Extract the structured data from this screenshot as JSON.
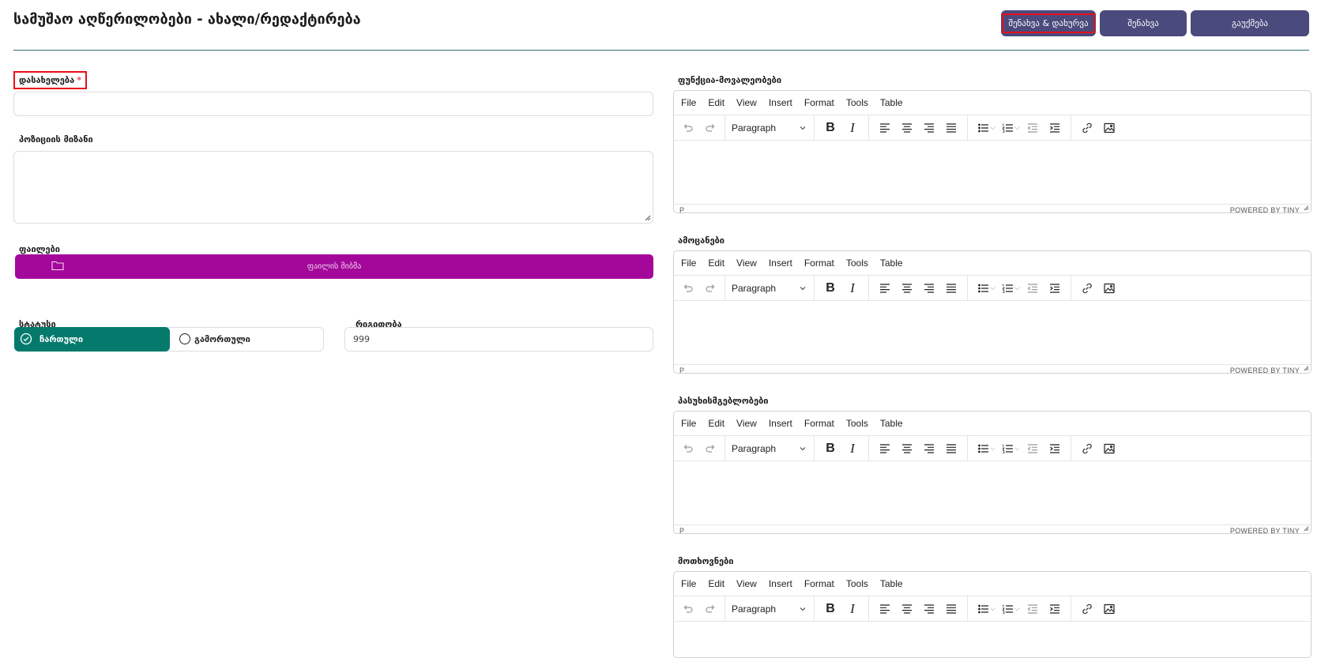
{
  "header": {
    "title": "სამუშაო აღწერილობები - ახალი/რედაქტირება",
    "buttons": {
      "save_close": "შენახვა & დახურვა",
      "save": "შენახვა",
      "cancel": "გაუქმება"
    }
  },
  "form": {
    "name_label": "დასახელება",
    "required_mark": "*",
    "name_value": "",
    "goal_label": "პოზიციის მიზანი",
    "goal_value": "",
    "files_label": "ფაილები",
    "upload_label": "ფაილის მიბმა",
    "status_label": "სტატუსი",
    "status_on": "ჩართული",
    "status_off": "გამორთული",
    "order_label": "რიგითობა",
    "order_value": "999"
  },
  "editors": [
    {
      "label": "ფუნქცია-მოვალეობები"
    },
    {
      "label": "ამოცანები"
    },
    {
      "label": "პასუხისმგებლობები"
    },
    {
      "label": "მოთხოვნები"
    }
  ],
  "editor_ui": {
    "menu": [
      "File",
      "Edit",
      "View",
      "Insert",
      "Format",
      "Tools",
      "Table"
    ],
    "block_format": "Paragraph",
    "bold": "B",
    "italic": "I",
    "path": "P",
    "powered": "POWERED BY TINY"
  },
  "colors": {
    "header_button": "#4a4a7d",
    "upload_button": "#a3089a",
    "status_active": "#057a6c",
    "highlight": "#e8101a"
  }
}
